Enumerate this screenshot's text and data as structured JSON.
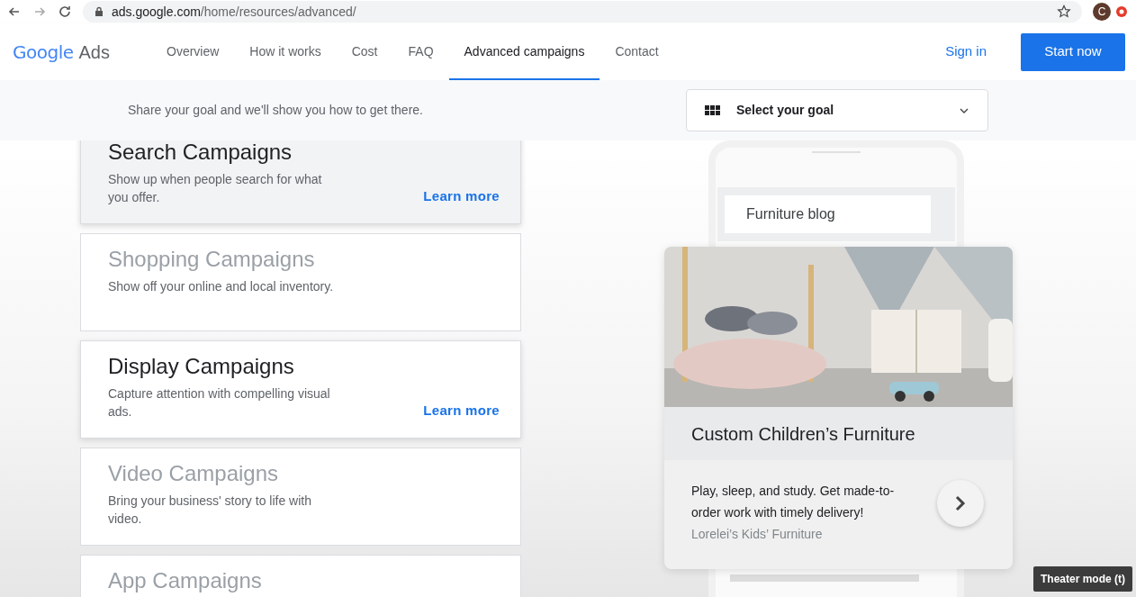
{
  "browser": {
    "url_host": "ads.google.com",
    "url_path": "/home/resources/advanced/",
    "avatar": "C"
  },
  "nav": {
    "logo_brand": "Google",
    "logo_product": "Ads",
    "links": [
      {
        "label": "Overview",
        "selected": false
      },
      {
        "label": "How it works",
        "selected": false
      },
      {
        "label": "Cost",
        "selected": false
      },
      {
        "label": "FAQ",
        "selected": false
      },
      {
        "label": "Advanced campaigns",
        "selected": true
      },
      {
        "label": "Contact",
        "selected": false
      }
    ],
    "sign_in": "Sign in",
    "start": "Start now"
  },
  "goal_bar": {
    "text": "Share your goal and we'll show you how to get there.",
    "select": "Select your goal"
  },
  "campaigns": [
    {
      "title": "Search Campaigns",
      "description": "Show up when people search for what you offer.",
      "active": true,
      "highlighted": true,
      "link": "Learn more"
    },
    {
      "title": "Shopping Campaigns",
      "description": "Show off your online and local inventory.",
      "active": false,
      "highlighted": false
    },
    {
      "title": "Display Campaigns",
      "description": "Capture attention with compelling visual ads.",
      "active": true,
      "highlighted": false,
      "link": "Learn more"
    },
    {
      "title": "Video Campaigns",
      "description": "Bring your business' story to life with video.",
      "active": false,
      "highlighted": false
    },
    {
      "title": "App Campaigns",
      "active": false,
      "highlighted": false
    }
  ],
  "preview": {
    "search_query": "Furniture blog",
    "ad_title": "Custom Children’s Furniture",
    "ad_text": "Play, sleep, and study. Get made-to-order work with timely delivery!",
    "advertiser": "Lorelei’s Kids’ Furniture"
  },
  "tooltip": "Theater mode (t)"
}
